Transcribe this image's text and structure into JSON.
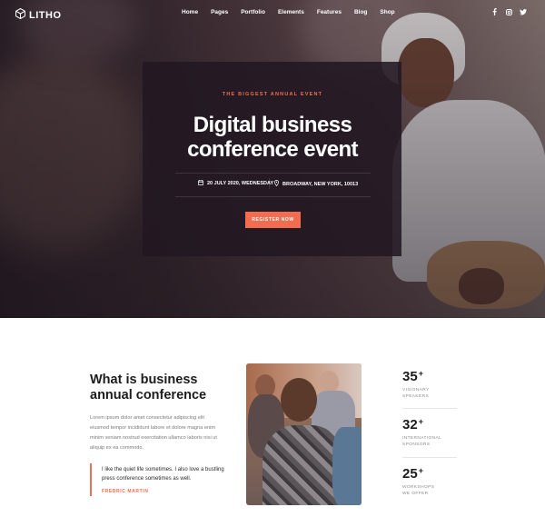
{
  "brand": {
    "name": "LITHO"
  },
  "nav": {
    "items": [
      "Home",
      "Pages",
      "Portfolio",
      "Elements",
      "Features",
      "Blog",
      "Shop"
    ],
    "social_icons": [
      "facebook-icon",
      "instagram-icon",
      "twitter-icon"
    ]
  },
  "hero": {
    "eyebrow": "THE BIGGEST ANNUAL EVENT",
    "title_line1": "Digital business",
    "title_line2": "conference event",
    "date": "20 JULY 2020, WEDNESDAY",
    "location": "BROADWAY, NEW YORK, 10013",
    "cta": "REGISTER NOW"
  },
  "about": {
    "title_line1": "What is business",
    "title_line2": "annual conference",
    "body": "Lorem ipsum dolor amet consectetur adipiscing elit eiusmod tempor incididunt labore et dolore magna enim minim veniam nostrud exercitation ullamco laboris nisi ut aliquip ex ea commodo.",
    "quote": "I like the quiet life sometimes. I also love a bustling press conference sometimes as well.",
    "quote_author": "FREDRIC MARTIN"
  },
  "stats": [
    {
      "value": "35",
      "suffix": "+",
      "label_line1": "VISIONARY",
      "label_line2": "SPEAKERS"
    },
    {
      "value": "32",
      "suffix": "+",
      "label_line1": "INTERNATIONAL",
      "label_line2": "SPONSORS"
    },
    {
      "value": "25",
      "suffix": "+",
      "label_line1": "WORKSHOPS",
      "label_line2": "WE OFFER"
    }
  ],
  "colors": {
    "accent": "#f26d4f",
    "card": "#221822",
    "heading": "#1c1c1c"
  }
}
